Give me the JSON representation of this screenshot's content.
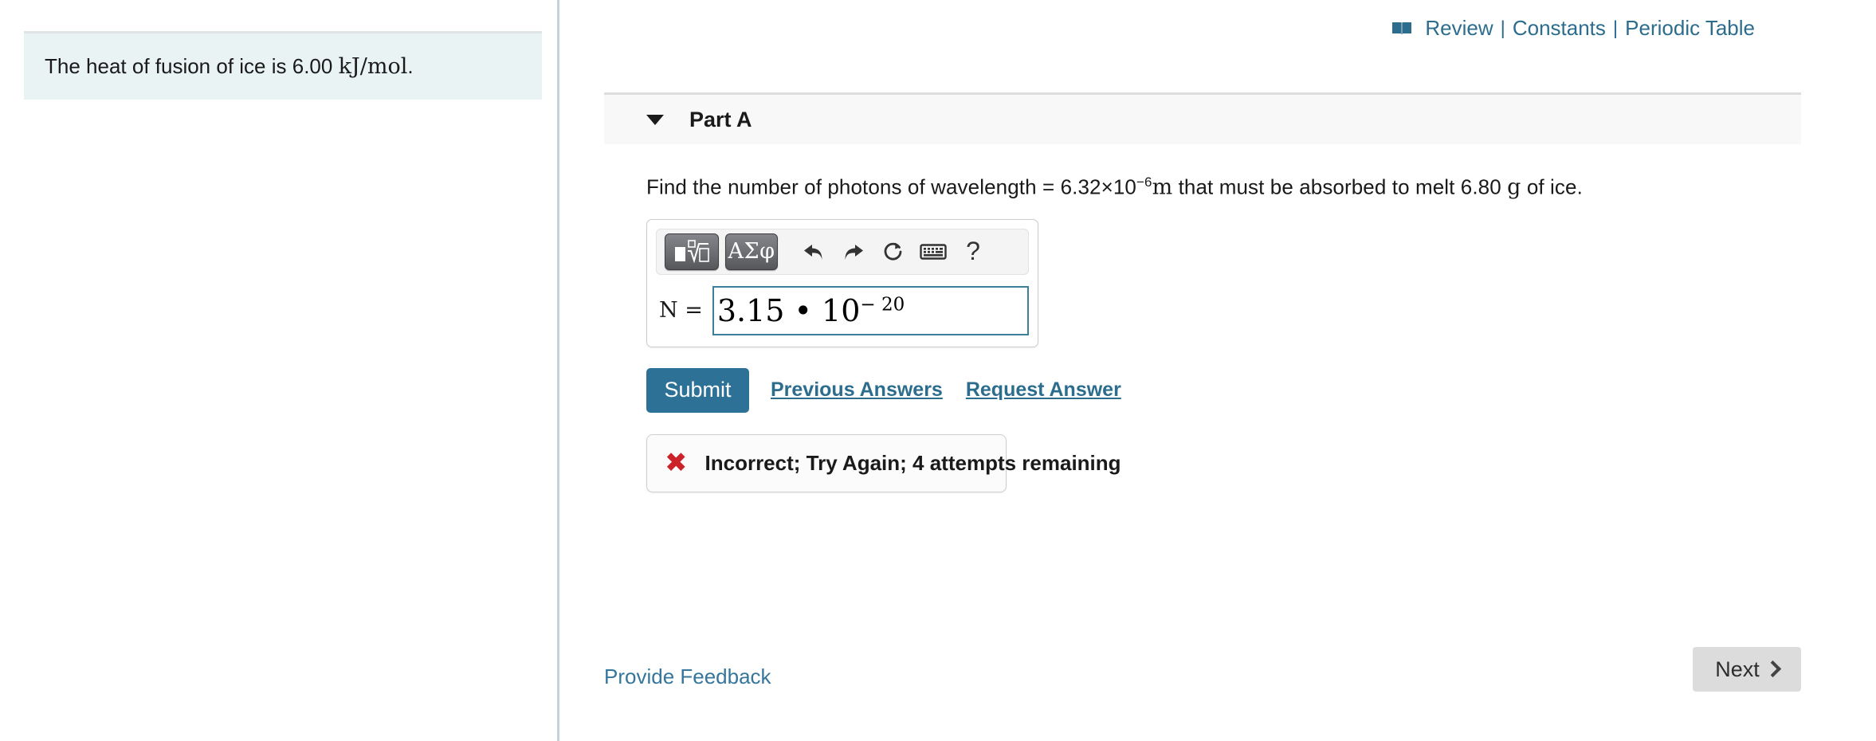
{
  "left_panel": {
    "intro_prefix": "The heat of fusion of ice is 6.00 ",
    "intro_units": "kJ/mol",
    "intro_suffix": "."
  },
  "header": {
    "book_icon": "open-book-icon",
    "review_label": "Review",
    "separator": "|",
    "constants_label": "Constants",
    "periodic_table_label": "Periodic Table",
    "link_color": "#2c6d8e"
  },
  "part": {
    "title": "Part A",
    "collapse_icon": "caret-down-icon",
    "question_pre": "Find the number of photons of wavelength = 6.32×10",
    "question_exponent": "−6",
    "question_unit_m": "m",
    "question_mid": " that must be absorbed to melt 6.80 ",
    "question_unit_g": "g",
    "question_post": " of ice."
  },
  "answer_widget": {
    "toolbar": {
      "template_button": "math-template-icon",
      "greek_button_label": "ΑΣφ",
      "undo_icon": "undo-arrow-icon",
      "redo_icon": "redo-arrow-icon",
      "reset_icon": "reset-circular-arrow-icon",
      "keyboard_icon": "keyboard-icon",
      "help_label": "?"
    },
    "variable_label": "N =",
    "value_mantissa": "3.15 • 10",
    "value_exponent": "− 20",
    "focus_border_color": "#3c7f9c"
  },
  "actions": {
    "submit_label": "Submit",
    "submit_color": "#2d7296",
    "previous_answers_label": "Previous Answers",
    "request_answer_label": "Request Answer"
  },
  "feedback": {
    "icon": "red-x-icon",
    "icon_glyph": "✖",
    "icon_color": "#cc2229",
    "message": "Incorrect; Try Again; 4 attempts remaining"
  },
  "footer": {
    "provide_feedback_label": "Provide Feedback",
    "next_label": "Next",
    "next_icon": "chevron-right-icon"
  }
}
